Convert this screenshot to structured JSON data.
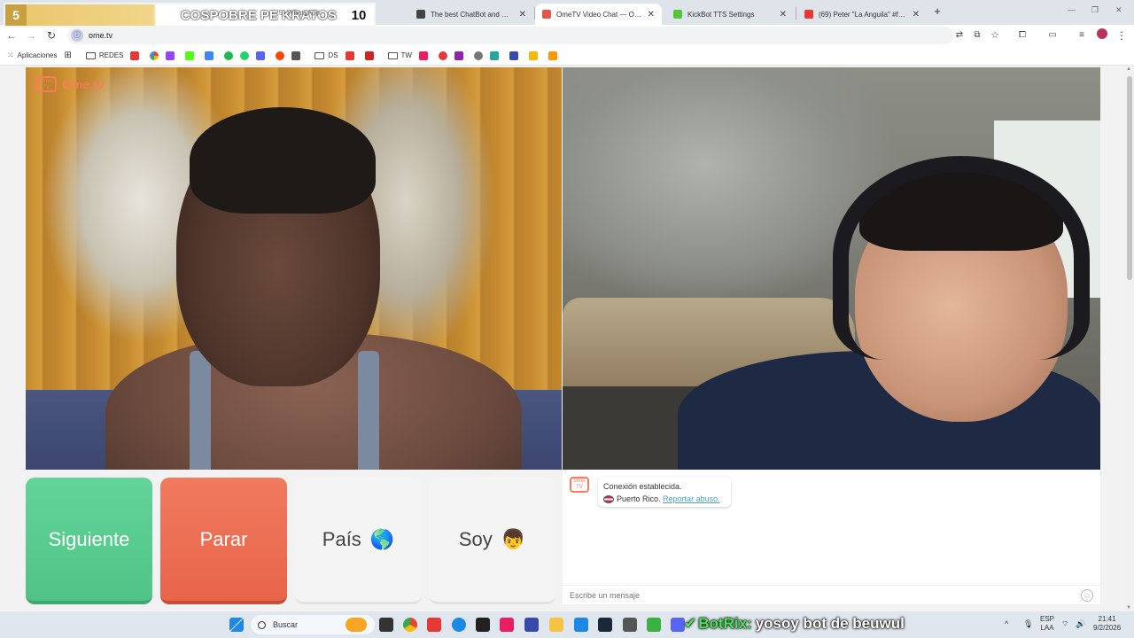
{
  "scoreboard": {
    "left_score": "5",
    "title": "COSPOBRE PE KRATOS",
    "right_score": "10",
    "underlying_tab": "(5) WhatsApp"
  },
  "tabs": [
    {
      "label": "The best ChatBot and Widgets",
      "color": "#444444"
    },
    {
      "label": "OmeTV Video Chat — Ome",
      "color": "#e2564a"
    },
    {
      "label": "KickBot TTS Settings",
      "color": "#53c43b"
    },
    {
      "label": "(69) Peter \"La Anguila\" #funny",
      "color": "#e53935"
    }
  ],
  "address": {
    "url": "ome.tv"
  },
  "bookmarks": {
    "apps_label": "Aplicaciones",
    "folder1": "REDES",
    "folder2": "DS",
    "folder3": "TW"
  },
  "brand": {
    "logo_badge": "Ome TV",
    "logo_name": "Ome.tv"
  },
  "controls": {
    "next_label": "Siguiente",
    "stop_label": "Parar",
    "country_label": "País",
    "country_emoji": "🌎",
    "gender_label": "Soy",
    "gender_emoji": "👦"
  },
  "chat": {
    "status": "Conexión establecida.",
    "country": "Puerto Rico.",
    "report_link": "Reportar abuso.",
    "placeholder": "Escribe un mensaje"
  },
  "taskbar": {
    "search_label": "Buscar",
    "bot_name": "BotRix:",
    "bot_message": "yosoy bot de beuwul",
    "lang_top": "ESP",
    "lang_bottom": "LAA",
    "time": "21:41",
    "date": "9/2/2026"
  },
  "colors": {
    "next": "#4fc485",
    "stop": "#e8654a",
    "brand": "#ff7a5c"
  }
}
